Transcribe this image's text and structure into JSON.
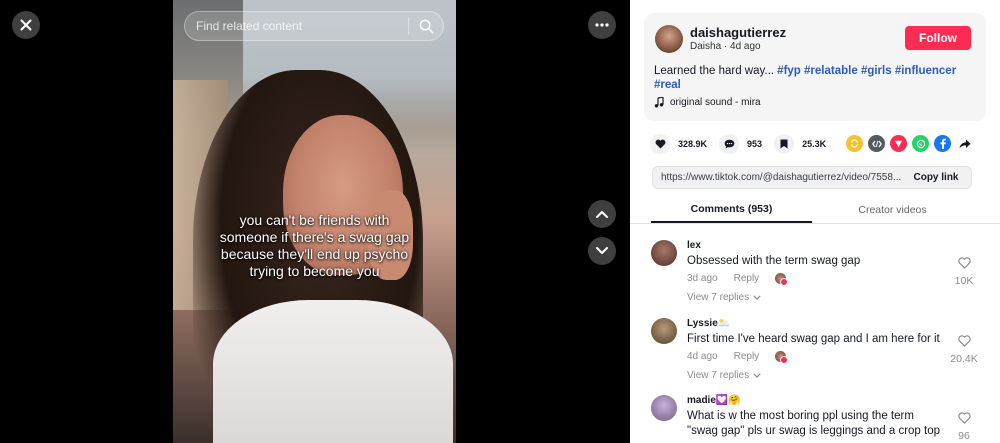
{
  "video": {
    "search_placeholder": "Find related content",
    "overlay_lines": [
      "you can't be friends with",
      "someone if there's a swag gap",
      "because they'll end up psycho",
      "trying to become you"
    ]
  },
  "author": {
    "username": "daishagutierrez",
    "display_name": "Daisha",
    "separator": " · ",
    "posted": "4d ago",
    "follow_label": "Follow"
  },
  "caption": {
    "text": "Learned the hard way... ",
    "hashtags": [
      "#fyp",
      "#relatable",
      "#girls",
      "#influencer",
      "#real"
    ]
  },
  "music": {
    "label": "original sound - mira"
  },
  "actions": {
    "likes": "328.9K",
    "comments": "953",
    "saves": "25.3K"
  },
  "share_icons": [
    {
      "name": "repost-icon",
      "color": "#fbc02d"
    },
    {
      "name": "embed-icon",
      "color": "#555a61"
    },
    {
      "name": "send-to-friend-icon",
      "color": "#fe2c55"
    },
    {
      "name": "whatsapp-icon",
      "color": "#25d366"
    },
    {
      "name": "facebook-icon",
      "color": "#1877f2"
    },
    {
      "name": "share-arrow-icon",
      "color": "#161823"
    }
  ],
  "link": {
    "url": "https://www.tiktok.com/@daishagutierrez/video/7558...",
    "copy_label": "Copy link"
  },
  "tabs": {
    "comments": "Comments (953)",
    "creator": "Creator videos"
  },
  "comments": [
    {
      "user": "lex",
      "text": "Obsessed with the term swag gap",
      "time": "3d ago",
      "reply_label": "Reply",
      "replies": "View 7 replies",
      "likes": "10K",
      "avatar_color": "#5b3a30"
    },
    {
      "user": "Lyssie🌥️",
      "text": "First time I've heard swag gap and I am here for it",
      "time": "4d ago",
      "reply_label": "Reply",
      "replies": "View 7 replies",
      "likes": "20.4K",
      "avatar_color": "#6b5a3a"
    },
    {
      "user": "madie💟🤗",
      "text": "What is w the most boring ppl using the term \"swag gap\" pls ur swag is leggings and a crop top",
      "likes": "96",
      "avatar_color": "#8d7aa8"
    }
  ],
  "colors": {
    "accent": "#fe2c55",
    "hashtag": "#2b5db9"
  }
}
